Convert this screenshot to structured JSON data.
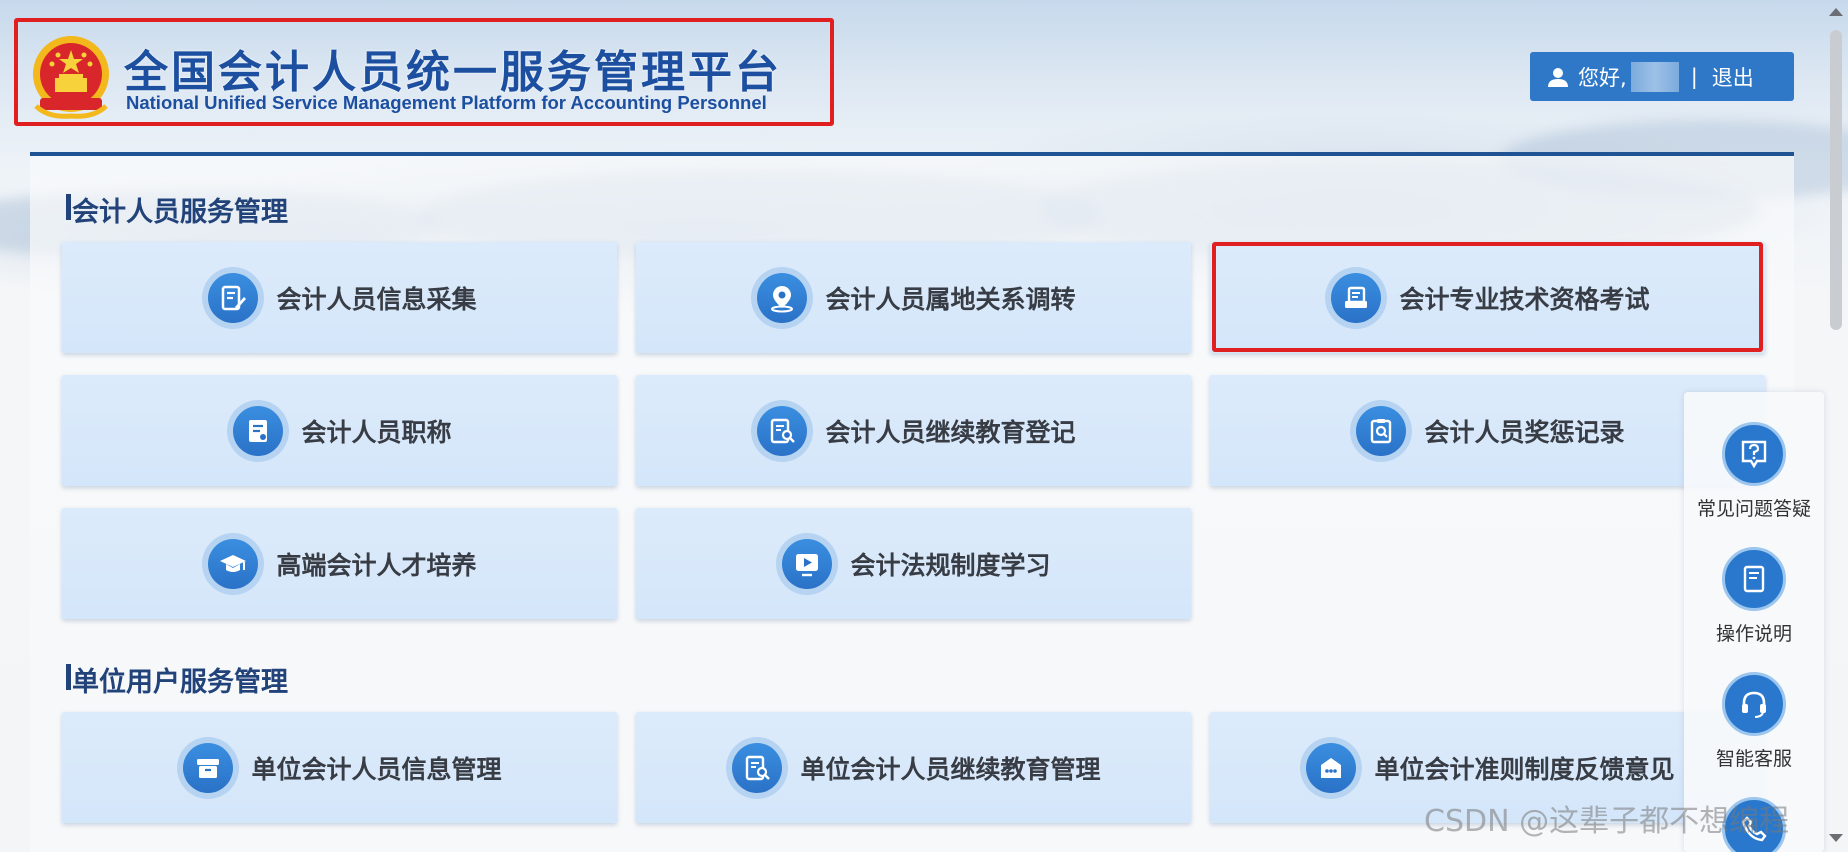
{
  "header": {
    "title": "全国会计人员统一服务管理平台",
    "subtitle": "National Unified Service Management Platform for Accounting Personnel",
    "greeting": "您好,",
    "separator": "|",
    "logout": "退出"
  },
  "sections": [
    {
      "title": "会计人员服务管理",
      "cards": [
        {
          "label": "会计人员信息采集",
          "icon": "form-edit-icon"
        },
        {
          "label": "会计人员属地关系调转",
          "icon": "location-pin-icon"
        },
        {
          "label": "会计专业技术资格考试",
          "icon": "exam-document-icon",
          "highlighted": true
        },
        {
          "label": "会计人员职称",
          "icon": "certificate-icon"
        },
        {
          "label": "会计人员继续教育登记",
          "icon": "document-search-icon"
        },
        {
          "label": "会计人员奖惩记录",
          "icon": "clipboard-search-icon"
        },
        {
          "label": "高端会计人才培养",
          "icon": "graduation-cap-icon"
        },
        {
          "label": "会计法规制度学习",
          "icon": "video-play-icon"
        }
      ]
    },
    {
      "title": "单位用户服务管理",
      "cards": [
        {
          "label": "单位会计人员信息管理",
          "icon": "archive-box-icon"
        },
        {
          "label": "单位会计人员继续教育管理",
          "icon": "document-search-icon"
        },
        {
          "label": "单位会计准则制度反馈意见",
          "icon": "feedback-bag-icon"
        }
      ]
    }
  ],
  "float_bar": [
    {
      "label": "常见问题答疑",
      "icon": "question-chat-icon"
    },
    {
      "label": "操作说明",
      "icon": "manual-book-icon"
    },
    {
      "label": "智能客服",
      "icon": "headset-icon"
    }
  ],
  "watermark": "CSDN @这辈子都不想编程",
  "colors": {
    "brand_blue": "#1d4fa0",
    "button_blue": "#2f78c8",
    "card_bg": "#d8e9fb",
    "highlight_red": "#e02020",
    "section_title": "#22437a"
  }
}
